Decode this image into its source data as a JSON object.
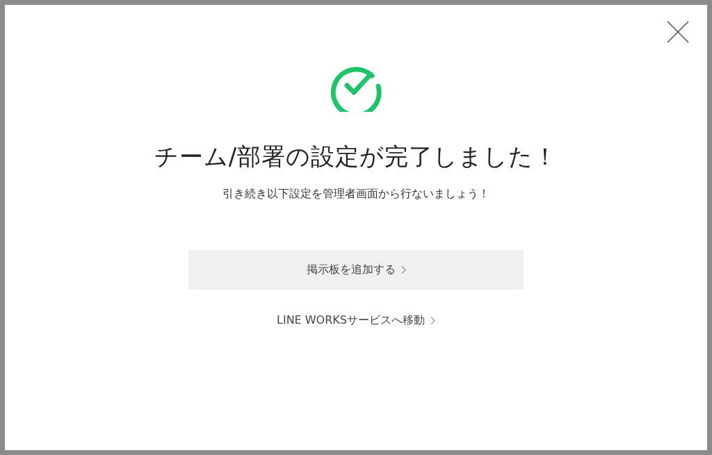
{
  "dialog": {
    "title": "チーム/部署の設定が完了しました！",
    "message": "引き続き以下設定を管理者画面から行ないましょう！"
  },
  "actions": [
    {
      "kind": "button",
      "label": "掲示板を追加する"
    },
    {
      "kind": "link",
      "label": "LINE WORKSサービスへ移動"
    }
  ]
}
